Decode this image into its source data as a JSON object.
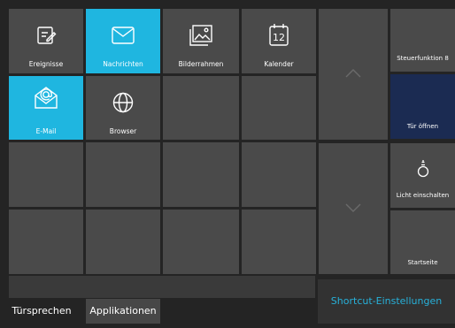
{
  "apps": [
    {
      "label": "Ereignisse",
      "icon": "events-icon",
      "active": false
    },
    {
      "label": "Nachrichten",
      "icon": "envelope-icon",
      "active": true
    },
    {
      "label": "Bilderrahmen",
      "icon": "picture-frame-icon",
      "active": false
    },
    {
      "label": "Kalender",
      "icon": "calendar-icon",
      "active": false,
      "calendar_day": "12"
    },
    {
      "label": "E-Mail",
      "icon": "email-icon",
      "active": true
    },
    {
      "label": "Browser",
      "icon": "globe-icon",
      "active": false
    }
  ],
  "shortcuts": {
    "steuerfunktion": "Steuerfunktion 8",
    "tuer": "Tür öffnen",
    "licht": "Licht einschalten",
    "start": "Startseite"
  },
  "tabs": [
    "Türsprechen",
    "Applikationen"
  ],
  "active_tab": "Applikationen",
  "shortcut_settings": "Shortcut-Einstellungen",
  "colors": {
    "active": "#1fb6e0",
    "accent": "#27b1da",
    "navy": "#1b2b52",
    "tile": "#4a4a4a"
  }
}
